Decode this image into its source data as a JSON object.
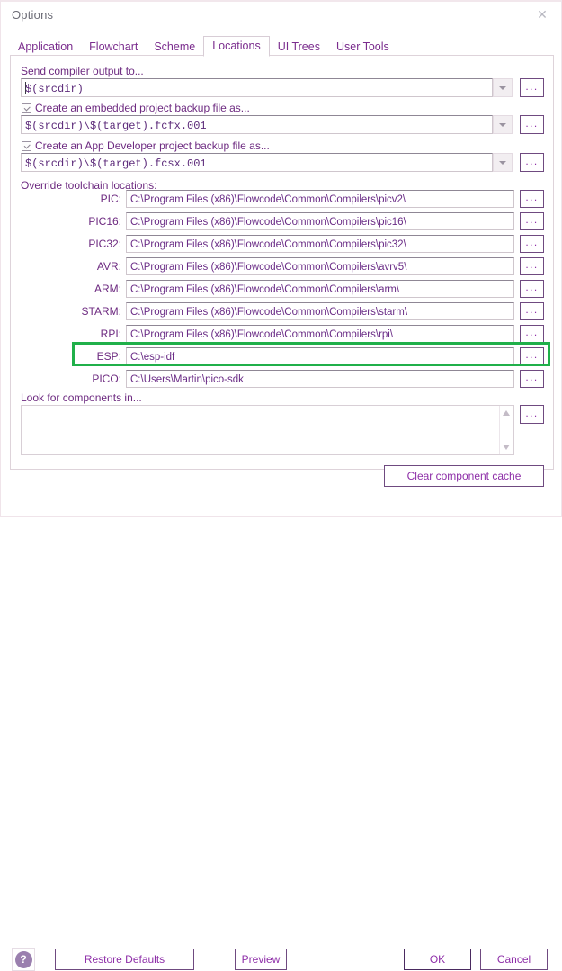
{
  "window": {
    "title": "Options",
    "close_icon": "close-icon"
  },
  "tabs": [
    {
      "label": "Application",
      "active": false
    },
    {
      "label": "Flowchart",
      "active": false
    },
    {
      "label": "Scheme",
      "active": false
    },
    {
      "label": "Locations",
      "active": true
    },
    {
      "label": "UI Trees",
      "active": false
    },
    {
      "label": "User Tools",
      "active": false
    }
  ],
  "output": {
    "label": "Send compiler output to...",
    "value": "$(srcdir)",
    "dropdown_icon": "chevron-down-icon",
    "browse_label": "..."
  },
  "embedded_backup": {
    "checked": true,
    "label": "Create an embedded project backup file as...",
    "value": "$(srcdir)\\$(target).fcfx.001",
    "dropdown_icon": "chevron-down-icon",
    "browse_label": "..."
  },
  "appdev_backup": {
    "checked": true,
    "label": "Create an App Developer project backup file as...",
    "value": "$(srcdir)\\$(target).fcsx.001",
    "dropdown_icon": "chevron-down-icon",
    "browse_label": "..."
  },
  "toolchain": {
    "label": "Override toolchain locations:",
    "browse_label": "...",
    "highlight_color": "#20b04a",
    "highlighted_row": "ESP",
    "rows": [
      {
        "name": "PIC:",
        "value": "C:\\Program Files (x86)\\Flowcode\\Common\\Compilers\\picv2\\"
      },
      {
        "name": "PIC16:",
        "value": "C:\\Program Files (x86)\\Flowcode\\Common\\Compilers\\pic16\\"
      },
      {
        "name": "PIC32:",
        "value": "C:\\Program Files (x86)\\Flowcode\\Common\\Compilers\\pic32\\"
      },
      {
        "name": "AVR:",
        "value": "C:\\Program Files (x86)\\Flowcode\\Common\\Compilers\\avrv5\\"
      },
      {
        "name": "ARM:",
        "value": "C:\\Program Files (x86)\\Flowcode\\Common\\Compilers\\arm\\"
      },
      {
        "name": "STARM:",
        "value": "C:\\Program Files (x86)\\Flowcode\\Common\\Compilers\\starm\\"
      },
      {
        "name": "RPI:",
        "value": "C:\\Program Files (x86)\\Flowcode\\Common\\Compilers\\rpi\\"
      },
      {
        "name": "ESP:",
        "value": "C:\\esp-idf"
      },
      {
        "name": "PICO:",
        "value": "C:\\Users\\Martin\\pico-sdk"
      }
    ]
  },
  "components": {
    "label": "Look for components in...",
    "value": "",
    "browse_label": "...",
    "scroll_up_icon": "triangle-up-icon",
    "scroll_down_icon": "triangle-down-icon",
    "clear_cache_label": "Clear component cache"
  },
  "footer": {
    "help_icon": "question-mark-icon",
    "restore_defaults_label": "Restore Defaults",
    "preview_label": "Preview",
    "ok_label": "OK",
    "cancel_label": "Cancel"
  }
}
